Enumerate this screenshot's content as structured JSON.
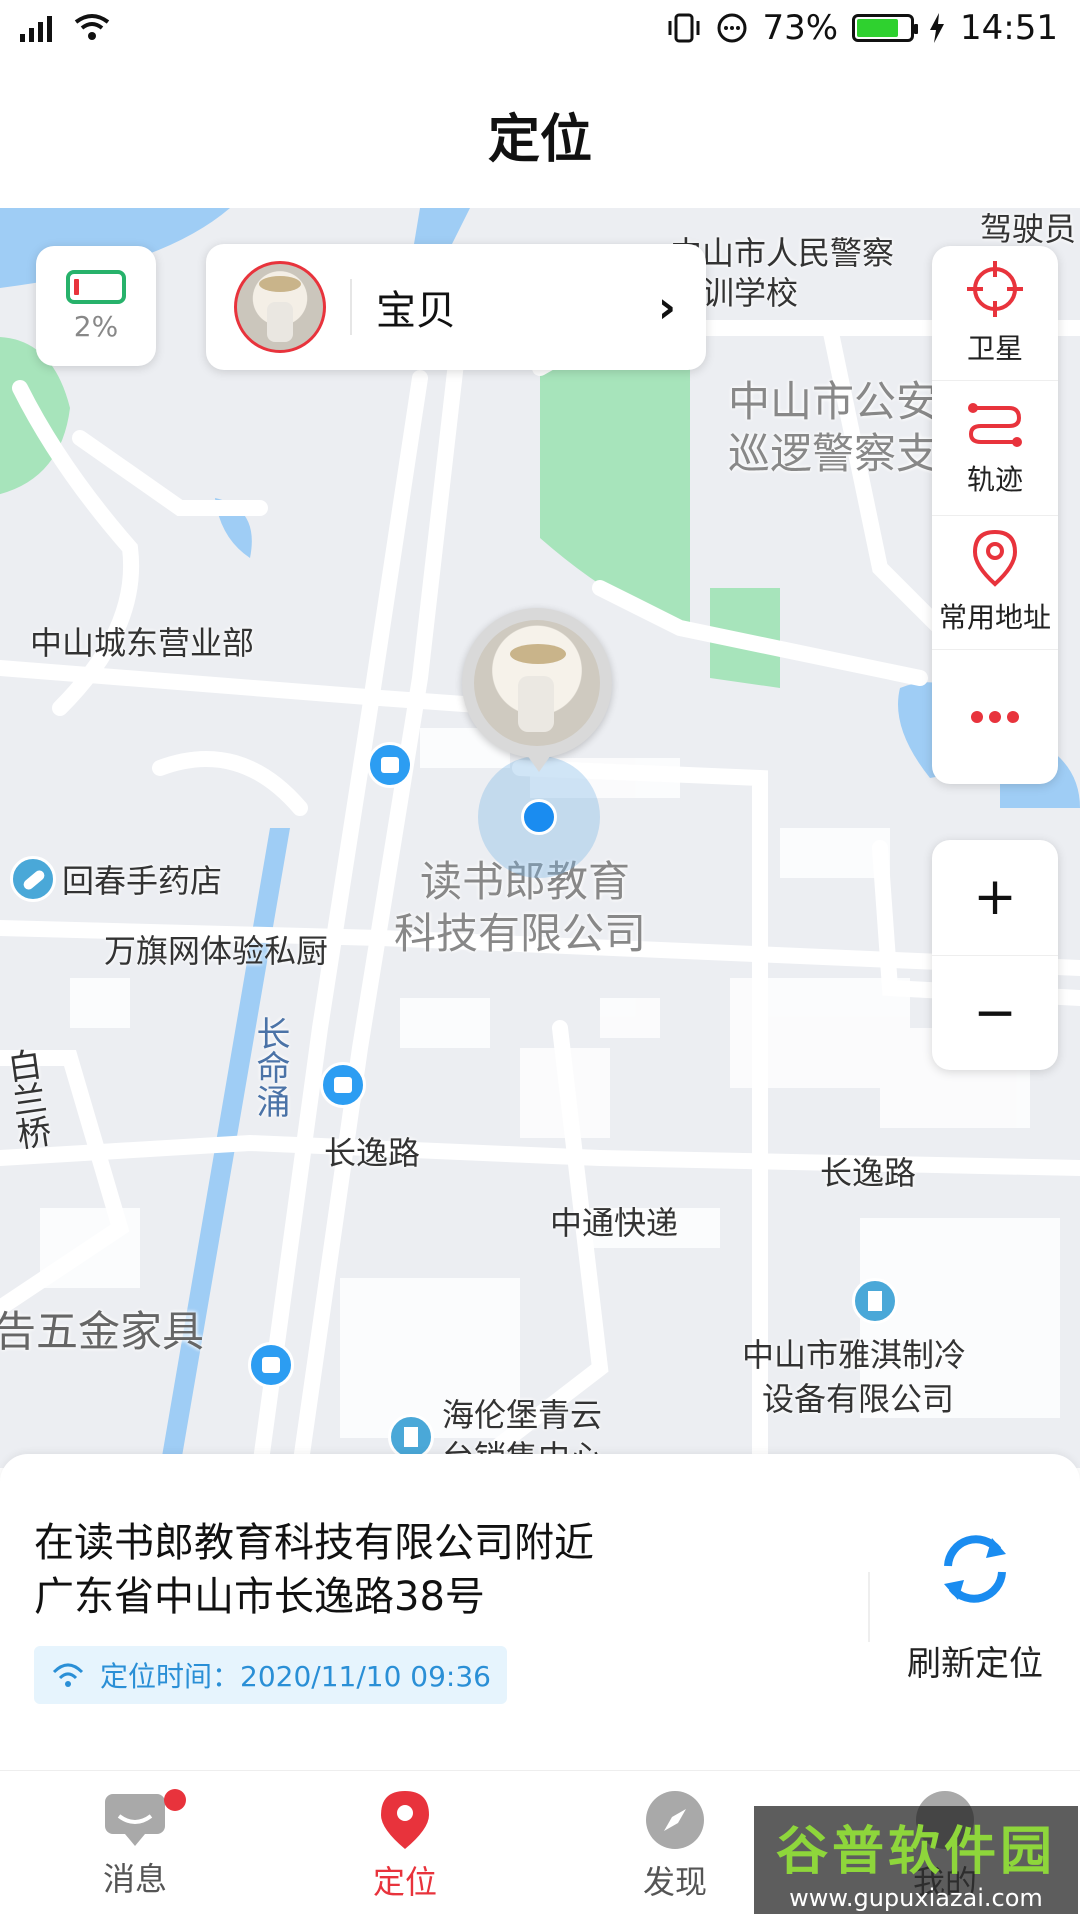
{
  "status_bar": {
    "battery_percent": "73%",
    "battery_level": 0.73,
    "time": "14:51"
  },
  "header": {
    "title": "定位"
  },
  "device": {
    "battery_percent": "2%",
    "battery_level": 0.02,
    "name": "宝贝"
  },
  "map": {
    "labels": {
      "police_school": "中山市人民警察",
      "police_school2": "培训学校",
      "driver": "驾驶员",
      "public_security": "中山市公安",
      "patrol": "巡逻警察支",
      "dongying": "中山城东营业部",
      "pharmacy": "回春手药店",
      "restaurant": "万旗网体验私厨",
      "company_a": "读书郎教育",
      "company_b": "科技有限公司",
      "river": "长命涌",
      "road_a": "长逸路",
      "road_b": "长逸路",
      "express": "中通快递",
      "hardware": "告五金家具",
      "refrigeration_a": "中山市雅淇制冷",
      "refrigeration_b": "设备有限公司",
      "sales_a": "海伦堡青云",
      "sales_b": "台销售中心",
      "baijiao": "白兰桥"
    }
  },
  "tools": {
    "satellite": "卫星",
    "track": "轨迹",
    "address": "常用地址",
    "zoom_in": "+",
    "zoom_out": "−"
  },
  "location": {
    "near": "在读书郎教育科技有限公司附近",
    "address": "广东省中山市长逸路38号",
    "time": "定位时间：2020/11/10 09:36",
    "refresh": "刷新定位"
  },
  "tabs": [
    {
      "label": "消息"
    },
    {
      "label": "定位"
    },
    {
      "label": "发现"
    },
    {
      "label": "我的"
    }
  ],
  "watermark": {
    "brand": "谷普软件园",
    "url": "www.gupuxiazai.com"
  },
  "colors": {
    "accent": "#e8333c",
    "blue": "#1a8cf0",
    "green_battery": "#2fd12f"
  }
}
